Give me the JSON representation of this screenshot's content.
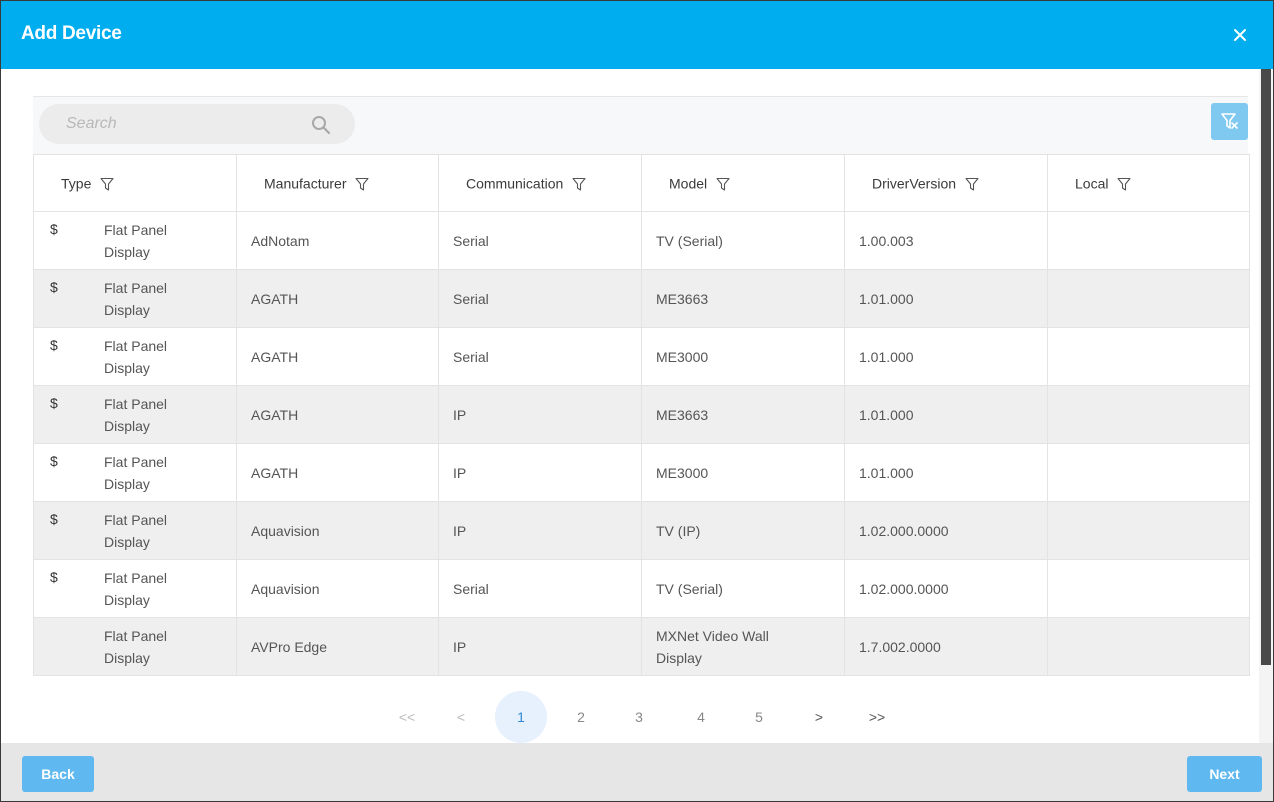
{
  "dialog": {
    "title": "Add Device",
    "close_icon": "close-icon"
  },
  "search": {
    "placeholder": "Search",
    "icon": "search-icon"
  },
  "filter_toggle": {
    "icon": "filter-clear-icon"
  },
  "table": {
    "columns": [
      "Type",
      "Manufacturer",
      "Communication",
      "Model",
      "DriverVersion",
      "Local"
    ],
    "rows": [
      {
        "paid": "$",
        "type": "Flat Panel Display",
        "manufacturer": "AdNotam",
        "communication": "Serial",
        "model": "TV (Serial)",
        "driver_version": "1.00.003",
        "local": ""
      },
      {
        "paid": "$",
        "type": "Flat Panel Display",
        "manufacturer": "AGATH",
        "communication": "Serial",
        "model": "ME3663",
        "driver_version": "1.01.000",
        "local": ""
      },
      {
        "paid": "$",
        "type": "Flat Panel Display",
        "manufacturer": "AGATH",
        "communication": "Serial",
        "model": "ME3000",
        "driver_version": "1.01.000",
        "local": ""
      },
      {
        "paid": "$",
        "type": "Flat Panel Display",
        "manufacturer": "AGATH",
        "communication": "IP",
        "model": "ME3663",
        "driver_version": "1.01.000",
        "local": ""
      },
      {
        "paid": "$",
        "type": "Flat Panel Display",
        "manufacturer": "AGATH",
        "communication": "IP",
        "model": "ME3000",
        "driver_version": "1.01.000",
        "local": ""
      },
      {
        "paid": "$",
        "type": "Flat Panel Display",
        "manufacturer": "Aquavision",
        "communication": "IP",
        "model": "TV (IP)",
        "driver_version": "1.02.000.0000",
        "local": ""
      },
      {
        "paid": "$",
        "type": "Flat Panel Display",
        "manufacturer": "Aquavision",
        "communication": "Serial",
        "model": "TV (Serial)",
        "driver_version": "1.02.000.0000",
        "local": ""
      },
      {
        "paid": "",
        "type": "Flat Panel Display",
        "manufacturer": "AVPro Edge",
        "communication": "IP",
        "model": "MXNet Video Wall Display",
        "driver_version": "1.7.002.0000",
        "local": ""
      }
    ]
  },
  "pagination": {
    "first": "<<",
    "prev": "<",
    "pages": [
      "1",
      "2",
      "3",
      "4",
      "5"
    ],
    "current": "1",
    "next": ">",
    "last": ">>"
  },
  "footer": {
    "back_label": "Back",
    "next_label": "Next"
  },
  "colors": {
    "header": "#00aeef",
    "button": "#5fb9f0",
    "active_page": "#e6f1fd"
  }
}
